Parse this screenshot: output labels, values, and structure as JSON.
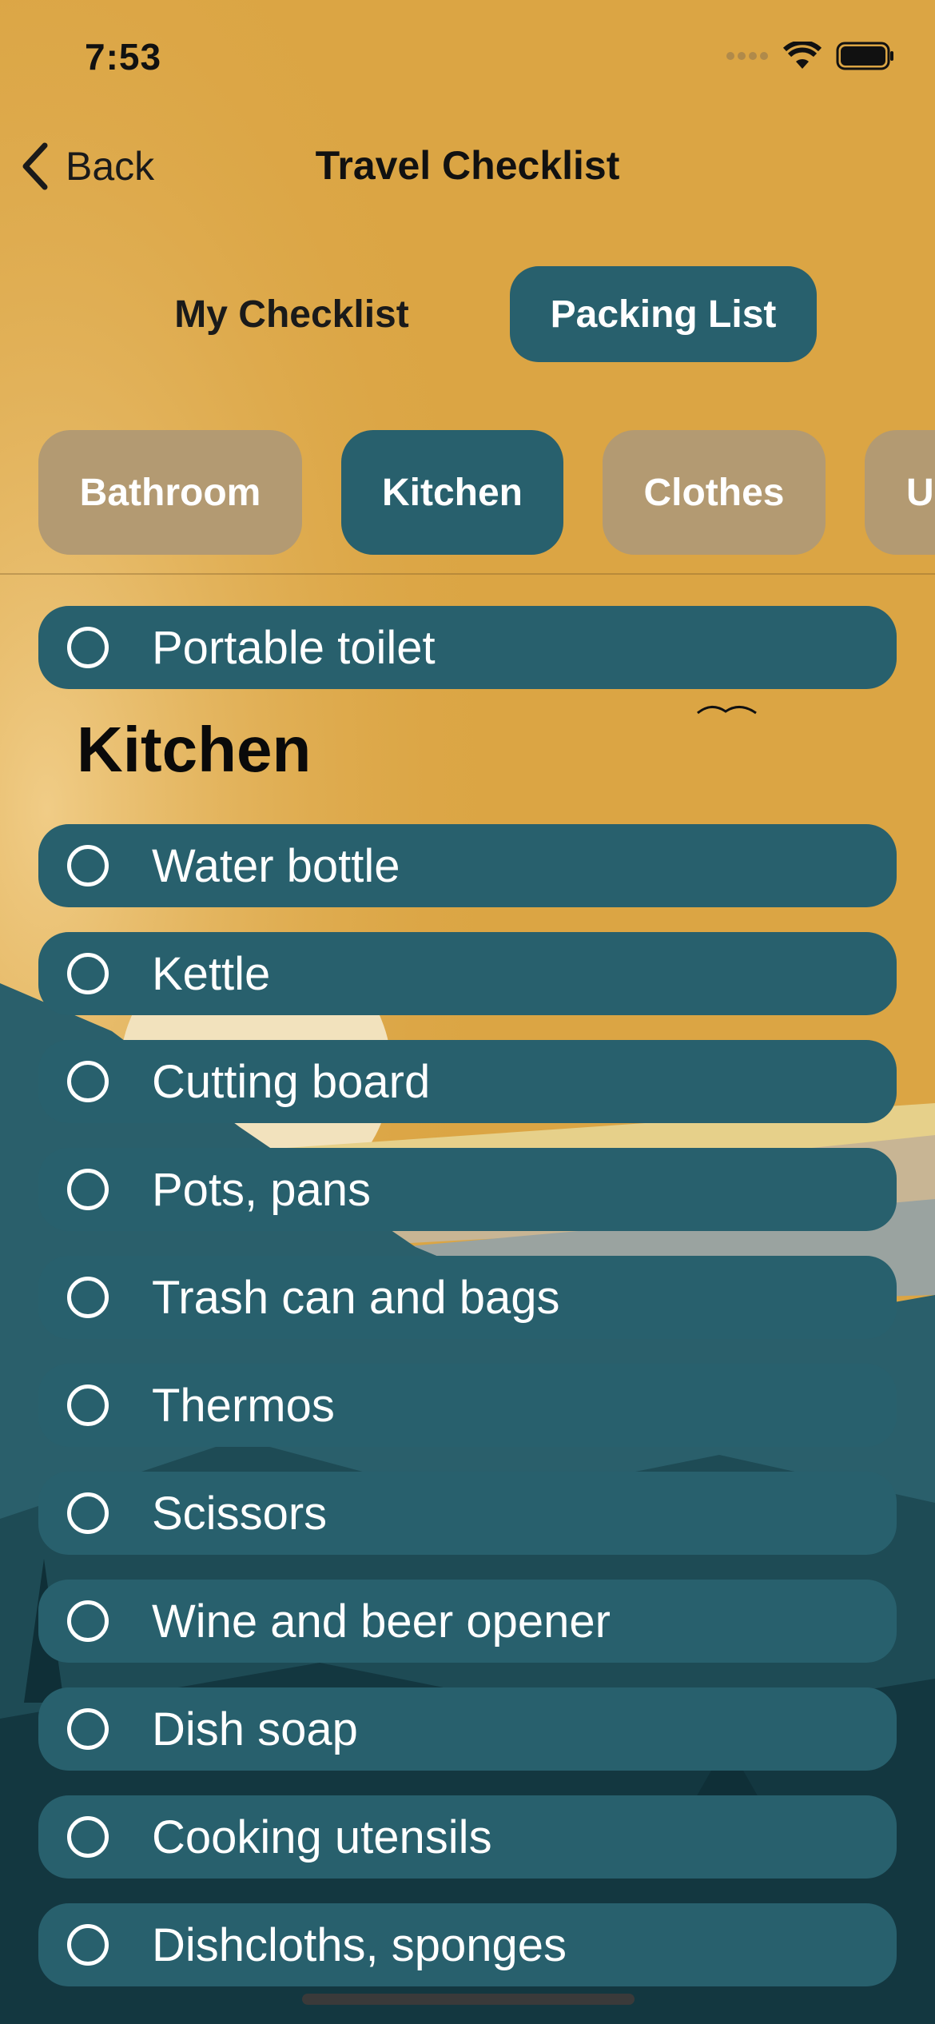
{
  "status_bar": {
    "time": "7:53"
  },
  "nav": {
    "back_label": "Back",
    "title": "Travel Checklist"
  },
  "segmented": {
    "tabs": [
      {
        "label": "My Checklist"
      },
      {
        "label": "Packing List"
      }
    ]
  },
  "categories": [
    {
      "label": "Bathroom"
    },
    {
      "label": "Kitchen"
    },
    {
      "label": "Clothes"
    },
    {
      "label": "U"
    }
  ],
  "previous_item": {
    "label": "Portable toilet"
  },
  "section": {
    "title": "Kitchen"
  },
  "items": [
    {
      "label": "Water bottle"
    },
    {
      "label": "Kettle"
    },
    {
      "label": "Cutting board"
    },
    {
      "label": "Pots, pans"
    },
    {
      "label": "Trash can and bags"
    },
    {
      "label": "Thermos"
    },
    {
      "label": "Scissors"
    },
    {
      "label": "Wine and beer opener"
    },
    {
      "label": "Dish soap"
    },
    {
      "label": "Cooking utensils"
    },
    {
      "label": "Dishcloths, sponges"
    }
  ],
  "colors": {
    "accent": "#28606d",
    "chip_inactive": "#b39a72",
    "background": "#dba544"
  }
}
